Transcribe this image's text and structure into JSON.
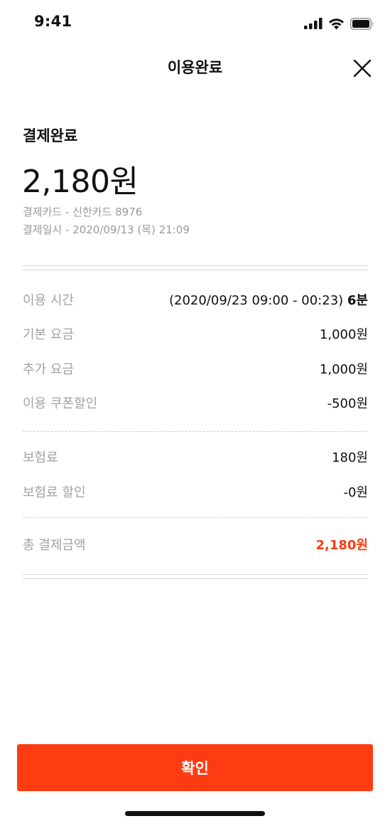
{
  "status_bar": {
    "time": "9:41",
    "icons": [
      "signal-icon",
      "wifi-icon",
      "battery-icon"
    ]
  },
  "nav": {
    "title": "이용완료",
    "close_icon": "close-icon"
  },
  "summary": {
    "label": "결제완료",
    "amount": "2,180원",
    "card_info": "결제카드 - 신한카드 8976",
    "paid_at": "결제일시 - 2020/09/13 (목) 21:09"
  },
  "details": {
    "usage_time": {
      "label": "이용 시간",
      "range": "(2020/09/23 09:00 - 00:23)",
      "duration": "6분"
    },
    "base_fee": {
      "label": "기본 요금",
      "value": "1,000원"
    },
    "extra_fee": {
      "label": "추가 요금",
      "value": "1,000원"
    },
    "coupon_discount": {
      "label": "이용 쿠폰할인",
      "value": "-500원"
    },
    "insurance": {
      "label": "보험료",
      "value": "180원"
    },
    "insurance_discount": {
      "label": "보험료 할인",
      "value": "-0원"
    },
    "total": {
      "label": "총 결제금액",
      "value": "2,180원"
    }
  },
  "confirm_button": {
    "label": "확인"
  },
  "colors": {
    "accent": "#ff3b12",
    "muted_text": "#a3a3a3",
    "text": "#111111"
  }
}
